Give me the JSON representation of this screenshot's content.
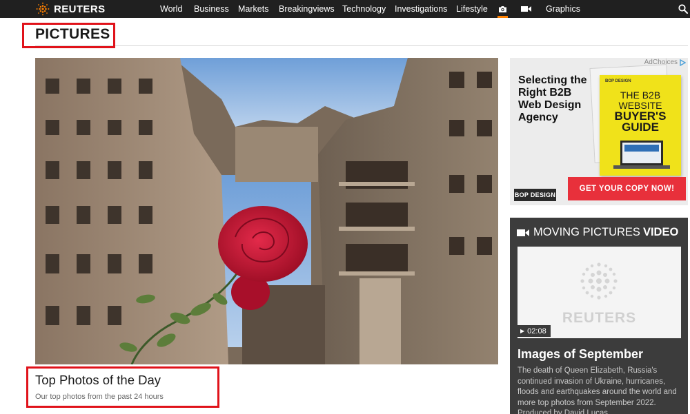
{
  "header": {
    "logo_text": "REUTERS",
    "nav": [
      "World",
      "Business",
      "Markets",
      "Breakingviews",
      "Technology",
      "Investigations",
      "Lifestyle"
    ],
    "nav_graphics": "Graphics",
    "icons": [
      "camera-icon",
      "video-icon",
      "search-icon"
    ]
  },
  "page": {
    "section_title": "PICTURES"
  },
  "feature": {
    "title": "Top Photos of the Day",
    "subtitle": "Our top photos from the past 24 hours"
  },
  "ad": {
    "adchoices": "AdChoices",
    "headline": "Selecting the Right B2B Web Design Agency",
    "book_top": "BOP DESIGN",
    "book_line1": "THE B2B",
    "book_line2": "WEBSITE",
    "book_line3": "BUYER'S",
    "book_line4": "GUIDE",
    "cta": "GET YOUR COPY NOW!",
    "brand": "BOP DESIGN"
  },
  "moving_pictures": {
    "label": "MOVING PICTURES",
    "label_bold": "VIDEO",
    "thumb_watermark": "REUTERS",
    "duration": "02:08",
    "title": "Images of September",
    "description": "The death of Queen Elizabeth, Russia's continued invasion of Ukraine, hurricanes, floods and earthquakes around the world and more top photos from September 2022. Produced by David Lucas."
  },
  "colors": {
    "nav_bg": "#202020",
    "accent_orange": "#ff8000",
    "highlight_red": "#e0121a",
    "ad_cta_red": "#e8303b",
    "ad_book_yellow": "#f0e21a",
    "widget_bg": "#3c3c3c"
  }
}
